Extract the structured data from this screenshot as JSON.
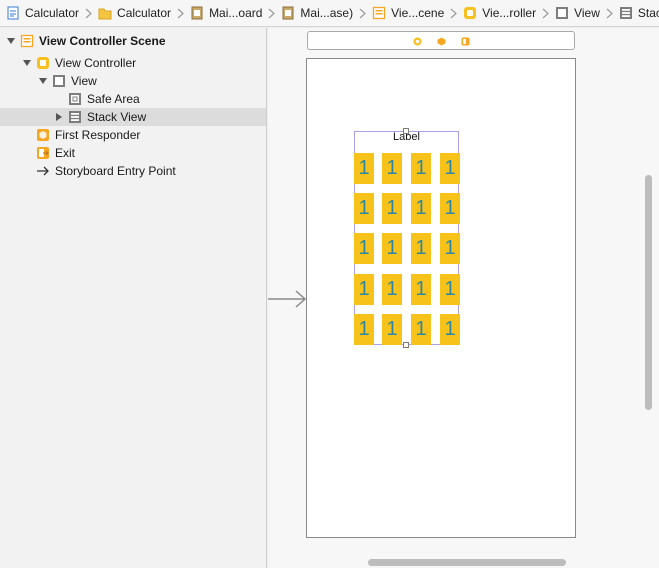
{
  "breadcrumb": [
    {
      "label": "Calculator",
      "icon": "swift-file-icon"
    },
    {
      "label": "Calculator",
      "icon": "folder-icon"
    },
    {
      "label": "Mai...oard",
      "icon": "storyboard-file-icon"
    },
    {
      "label": "Mai...ase)",
      "icon": "storyboard-file-icon"
    },
    {
      "label": "Vie...cene",
      "icon": "scene-icon"
    },
    {
      "label": "Vie...roller",
      "icon": "view-controller-icon"
    },
    {
      "label": "View",
      "icon": "view-icon"
    },
    {
      "label": "Stack View",
      "icon": "stack-view-icon"
    }
  ],
  "outline": {
    "items": [
      {
        "label": "View Controller Scene",
        "icon": "scene-icon",
        "expanded": true
      },
      {
        "label": "View Controller",
        "icon": "view-controller-icon",
        "expanded": true
      },
      {
        "label": "View",
        "icon": "view-icon",
        "expanded": true
      },
      {
        "label": "Safe Area",
        "icon": "safe-area-icon"
      },
      {
        "label": "Stack View",
        "icon": "stack-view-icon",
        "expanded": false,
        "selected": true
      },
      {
        "label": "First Responder",
        "icon": "first-responder-icon"
      },
      {
        "label": "Exit",
        "icon": "exit-icon"
      },
      {
        "label": "Storyboard Entry Point",
        "icon": "entry-arrow-icon"
      }
    ]
  },
  "canvas": {
    "scene_bar_icons": [
      "view-controller-icon",
      "first-responder-icon",
      "exit-icon"
    ],
    "stack_label": "Label",
    "grid_rows": 5,
    "grid_cols": 4,
    "cell_text": "1"
  },
  "colors": {
    "cell_fill": "#f7c31a",
    "cell_text": "#2d86a3",
    "selection_outline": "#a99fe6",
    "icon_orange": "#f5a623"
  }
}
